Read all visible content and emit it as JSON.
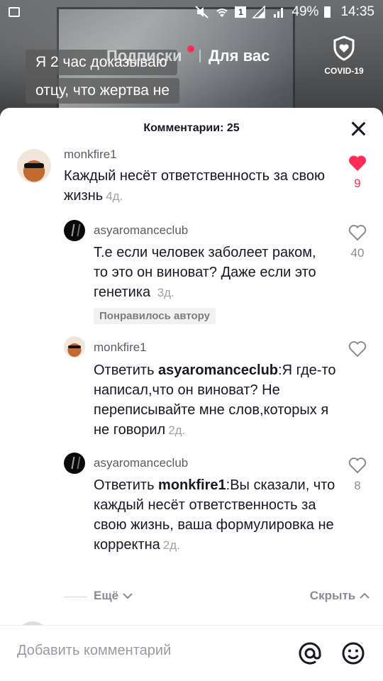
{
  "status_bar": {
    "battery": "49%",
    "time": "14:35",
    "sim": "1"
  },
  "nav": {
    "following": "Подписки",
    "for_you": "Для вас",
    "covid_label": "COVID-19"
  },
  "caption_lines": [
    "Я 2 час доказываю",
    "отцу, что жертва не"
  ],
  "comments_sheet": {
    "title": "Комментарии: 25",
    "comments": [
      {
        "user": "monkfire1",
        "text": "Каждый несёт ответственность за свою жизнь",
        "time": "4д.",
        "likes": "9",
        "liked": true
      },
      {
        "user": "asyaromanceclub",
        "text": "Т.е если человек заболеет раком, то это он виноват? Даже если это генетика ",
        "time": "3д.",
        "likes": "40",
        "badge": "Понравилось автору"
      },
      {
        "user": "monkfire1",
        "reply_prefix": "Ответить ",
        "reply_to": "asyaromanceclub",
        "text": ":Я где-то написал,что он виноват? Не переписывайте мне слов,которых я не говорил",
        "time": "2д.",
        "likes": ""
      },
      {
        "user": "asyaromanceclub",
        "reply_prefix": "Ответить ",
        "reply_to": "monkfire1",
        "text": ":Вы сказали, что каждый несёт ответственность за свою жизнь, ваша формулировка не корректна",
        "time": "2д.",
        "likes": "8"
      }
    ],
    "more_label": "Ещё",
    "hide_label": "Скрыть",
    "input_placeholder": "Добавить комментарий"
  },
  "colors": {
    "like_red": "#fe2c55",
    "text_primary": "#161823",
    "text_secondary": "#8a8b91"
  }
}
